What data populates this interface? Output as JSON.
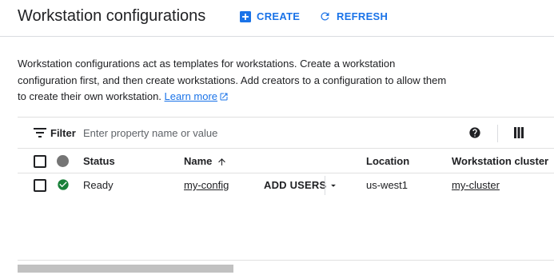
{
  "header": {
    "title": "Workstation configurations",
    "create_label": "CREATE",
    "refresh_label": "REFRESH"
  },
  "description": {
    "text": "Workstation configurations act as templates for workstations. Create a workstation configuration first, and then create workstations. Add creators to a configuration to allow them to create their own workstation.",
    "learn_more": "Learn more"
  },
  "filter": {
    "label": "Filter",
    "placeholder": "Enter property name or value"
  },
  "table": {
    "columns": {
      "status": "Status",
      "name": "Name",
      "location": "Location",
      "cluster": "Workstation cluster"
    },
    "rows": [
      {
        "status": "Ready",
        "name": "my-config",
        "action": "ADD USERS",
        "location": "us-west1",
        "cluster": "my-cluster"
      }
    ]
  },
  "icons": {
    "create": "add-box-icon",
    "refresh": "refresh-icon",
    "filter": "filter-list-icon",
    "help": "help-icon",
    "columns": "column-display-icon",
    "sort": "arrow-upward-icon",
    "status_ok": "check-circle-icon",
    "dropdown": "arrow-drop-down-icon",
    "external": "open-in-new-icon"
  },
  "colors": {
    "accent": "#1a73e8",
    "success": "#188038",
    "neutral_dot": "#757575"
  }
}
